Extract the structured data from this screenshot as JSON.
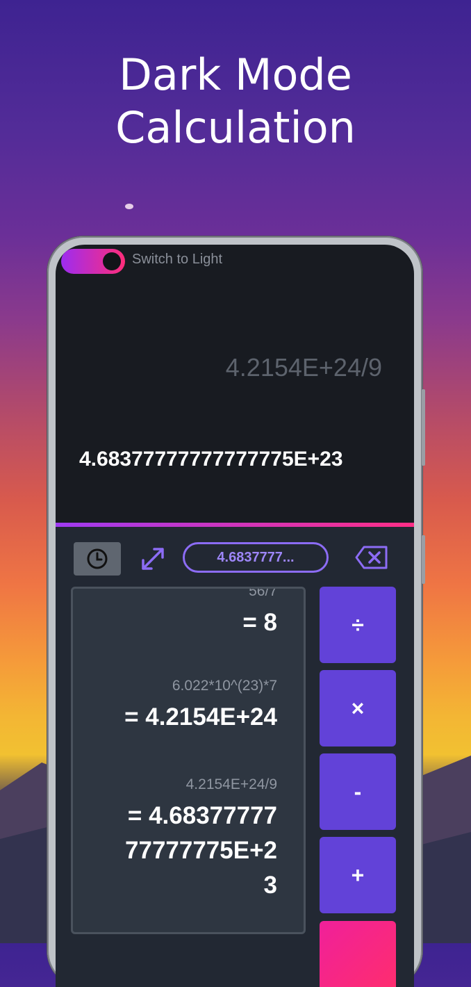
{
  "headline": {
    "line1": "Dark Mode",
    "line2": "Calculation"
  },
  "toggle": {
    "label": "Switch to Light",
    "state": "dark"
  },
  "display": {
    "expression": "4.2154E+24/9",
    "result": "4.68377777777777775E+23"
  },
  "toolbar": {
    "history_icon": "clock-icon",
    "expand_icon": "expand-arrows-icon",
    "pill_value": "4.6837777...",
    "backspace_icon": "backspace-icon"
  },
  "history": [
    {
      "expression": "56/7",
      "result": "= 8"
    },
    {
      "expression": "6.022*10^(23)*7",
      "result": "= 4.2154E+24"
    },
    {
      "expression": "4.2154E+24/9",
      "result_lines": [
        "= 4.68377777",
        "77777775E+2",
        "3"
      ]
    }
  ],
  "operators": {
    "divide": "÷",
    "multiply": "×",
    "subtract": "-",
    "add": "+"
  },
  "colors": {
    "accent": "#6242d8",
    "accent_gradient_start": "#9d2cf0",
    "accent_gradient_end": "#ff2d7a",
    "screen_bg": "#181b21"
  }
}
